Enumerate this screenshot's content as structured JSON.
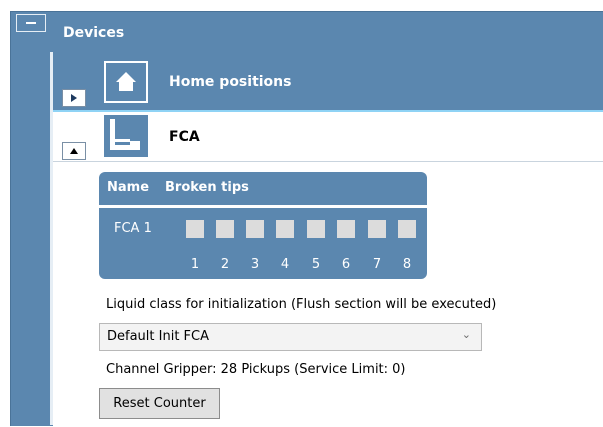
{
  "colors": {
    "panel": "#5b87af",
    "panel_border": "#4a7398",
    "accent_line": "#8fd3f5",
    "tip_square": "#dcdcdc",
    "header_text": "#ffffff"
  },
  "devices_panel": {
    "title": "Devices",
    "collapse_icon": "minus-icon"
  },
  "home_positions": {
    "title": "Home positions",
    "icon": "home-icon",
    "expander_icon": "triangle-right-icon"
  },
  "fca": {
    "title": "FCA",
    "icon": "channel-arm-icon",
    "expander_icon": "triangle-up-icon",
    "broken_tips": {
      "header_name": "Name",
      "header_broken": "Broken tips",
      "channel_label": "FCA 1",
      "tips": [
        "1",
        "2",
        "3",
        "4",
        "5",
        "6",
        "7",
        "8"
      ]
    },
    "liquid_class_label": "Liquid class for initialization (Flush section will be executed)",
    "liquid_class_selected": "Default Init FCA",
    "dropdown_icon": "chevron-down-icon",
    "gripper_status": "Channel Gripper: 28 Pickups (Service Limit: 0)",
    "reset_button_label": "Reset Counter"
  }
}
